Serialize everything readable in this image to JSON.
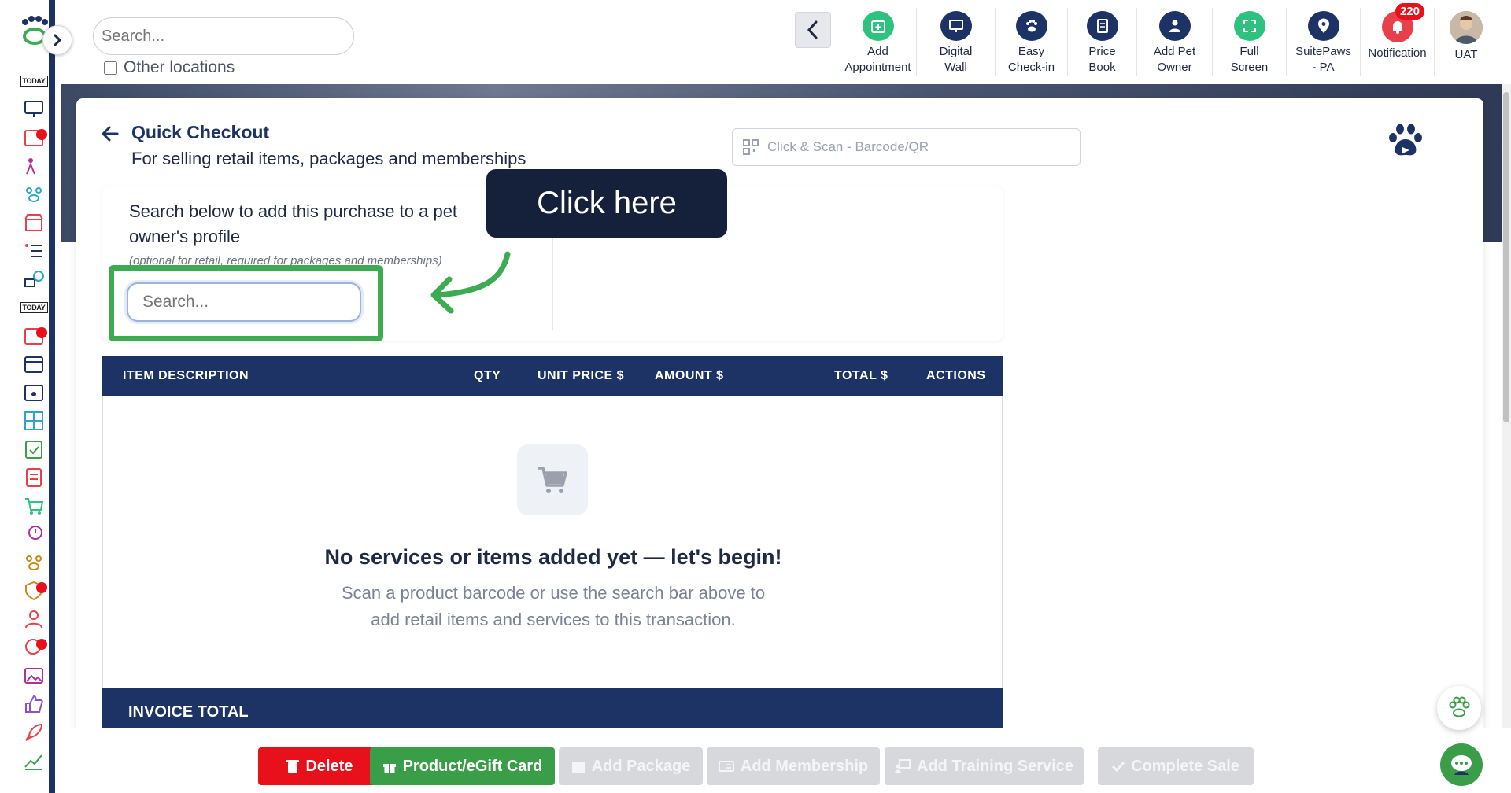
{
  "header": {
    "search_placeholder": "Search...",
    "other_locations_label": "Other locations",
    "tools": [
      {
        "label": "Add\nAppointment",
        "icon": "calendar-plus-icon",
        "color": "#2ec27e"
      },
      {
        "label": "Digital\nWall",
        "icon": "monitor-icon",
        "color": "#1d3366"
      },
      {
        "label": "Easy\nCheck-in",
        "icon": "paw-icon",
        "color": "#1d3366"
      },
      {
        "label": "Price\nBook",
        "icon": "document-icon",
        "color": "#1d3366"
      },
      {
        "label": "Add Pet\nOwner",
        "icon": "user-plus-icon",
        "color": "#1d3366"
      },
      {
        "label": "Full\nScreen",
        "icon": "expand-icon",
        "color": "#2ec27e"
      },
      {
        "label": "SuitePaws\n- PA",
        "icon": "location-pin-icon",
        "color": "#1d3366"
      },
      {
        "label": "Notification",
        "icon": "bell-icon",
        "color": "#e8404a",
        "badge": "220"
      },
      {
        "label": "UAT",
        "icon": "avatar",
        "color": "#8a8f99"
      }
    ]
  },
  "page": {
    "title": "Quick Checkout",
    "subtitle": "For selling retail items, packages and memberships",
    "scan_placeholder": "Click & Scan - Barcode/QR"
  },
  "owner": {
    "prompt": "Search below to add this purchase to a pet owner's profile",
    "note": "(optional for retail, required for packages and memberships)",
    "search_placeholder": "Search..."
  },
  "callout": {
    "text": "Click here"
  },
  "table": {
    "columns": [
      "ITEM DESCRIPTION",
      "QTY",
      "UNIT PRICE $",
      "AMOUNT $",
      "TOTAL $",
      "ACTIONS"
    ],
    "empty_title": "No services or items added yet — let's begin!",
    "empty_desc_line1": "Scan a product barcode or use the search bar above to",
    "empty_desc_line2": "add retail items and services to this transaction.",
    "invoice_total_label": "INVOICE TOTAL"
  },
  "actions": {
    "delete": "Delete",
    "product": "Product/eGift Card",
    "add_package": "Add Package",
    "add_membership": "Add Membership",
    "add_training": "Add Training Service",
    "complete_sale": "Complete Sale"
  },
  "colors": {
    "brand_navy": "#1d3366",
    "accent_green": "#3a9e48",
    "danger_red": "#e8101a"
  }
}
